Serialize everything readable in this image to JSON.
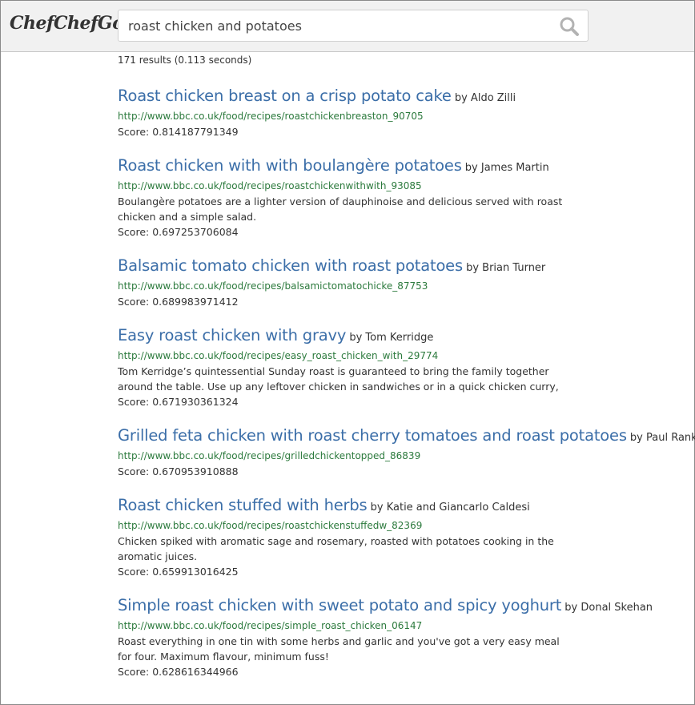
{
  "header": {
    "logo": "ChefChefGo",
    "search": {
      "value": "roast chicken and potatoes",
      "placeholder": ""
    }
  },
  "results_stats": "171 results (0.113 seconds)",
  "results": [
    {
      "title": "Roast chicken breast on a crisp potato cake",
      "author": "by Aldo Zilli",
      "url": "http://www.bbc.co.uk/food/recipes/roastchickenbreaston_90705",
      "description": "",
      "score": "Score: 0.814187791349"
    },
    {
      "title": "Roast chicken with with boulangère potatoes",
      "author": "by James Martin",
      "url": "http://www.bbc.co.uk/food/recipes/roastchickenwithwith_93085",
      "description": "Boulangère potatoes are a lighter version of dauphinoise and delicious served with roast chicken and a simple salad.",
      "score": "Score: 0.697253706084"
    },
    {
      "title": "Balsamic tomato chicken with roast potatoes",
      "author": "by Brian Turner",
      "url": "http://www.bbc.co.uk/food/recipes/balsamictomatochicke_87753",
      "description": "",
      "score": "Score: 0.689983971412"
    },
    {
      "title": "Easy roast chicken with gravy",
      "author": "by Tom Kerridge",
      "url": "http://www.bbc.co.uk/food/recipes/easy_roast_chicken_with_29774",
      "description": "Tom Kerridge’s quintessential Sunday roast is guaranteed to bring the family together around the table. Use up any leftover chicken in sandwiches or in a quick chicken curry,",
      "score": "Score: 0.671930361324"
    },
    {
      "title": "Grilled feta chicken with roast cherry tomatoes and roast potatoes",
      "author": "by Paul Rankin",
      "url": "http://www.bbc.co.uk/food/recipes/grilledchickentopped_86839",
      "description": "",
      "score": "Score: 0.670953910888"
    },
    {
      "title": "Roast chicken stuffed with herbs",
      "author": "by Katie and Giancarlo Caldesi",
      "url": "http://www.bbc.co.uk/food/recipes/roastchickenstuffedw_82369",
      "description": "Chicken spiked with aromatic sage and rosemary, roasted with potatoes cooking in the aromatic juices.",
      "score": "Score: 0.659913016425"
    },
    {
      "title": "Simple roast chicken with sweet potato and spicy yoghurt",
      "author": "by Donal Skehan",
      "url": "http://www.bbc.co.uk/food/recipes/simple_roast_chicken_06147",
      "description": "Roast everything in one tin with some herbs and garlic and you've got a very easy meal for four. Maximum flavour, minimum fuss!",
      "score": "Score: 0.628616344966"
    }
  ],
  "colors": {
    "link": "#3b6ea8",
    "url": "#2c7a3d",
    "header_bg": "#f1f1f1"
  },
  "icons": {
    "search": "search-icon"
  }
}
